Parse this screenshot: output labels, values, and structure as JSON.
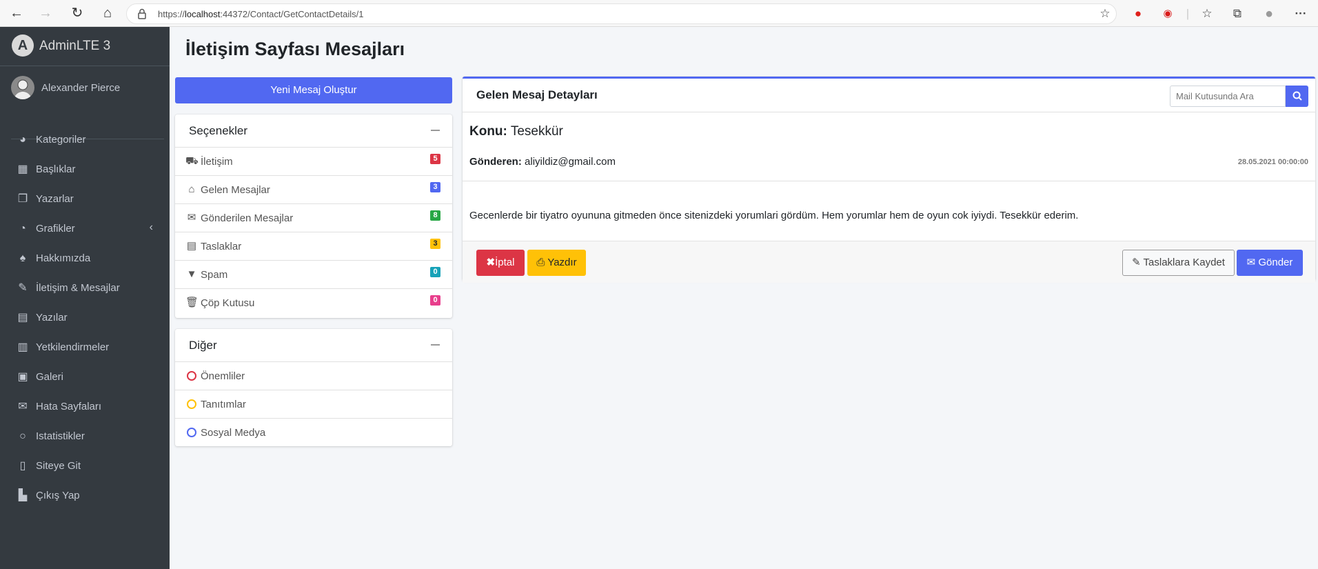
{
  "browser": {
    "url_prefix": "https://",
    "url_host": "localhost",
    "url_rest": ":44372/Contact/GetContactDetails/1"
  },
  "sidebar": {
    "brand": "AdminLTE 3",
    "user_name": "Alexander Pierce",
    "items": [
      {
        "label": "Kategoriler",
        "icon": "dashboard-icon"
      },
      {
        "label": "Başlıklar",
        "icon": "grid-icon"
      },
      {
        "label": "Yazarlar",
        "icon": "copy-icon"
      },
      {
        "label": "Grafikler",
        "icon": "pie-chart-icon"
      },
      {
        "label": "Hakkımızda",
        "icon": "tree-icon"
      },
      {
        "label": "İletişim & Mesajlar",
        "icon": "edit-icon"
      },
      {
        "label": "Yazılar",
        "icon": "table-icon"
      },
      {
        "label": "Yetkilendirmeler",
        "icon": "calendar-icon"
      },
      {
        "label": "Galeri",
        "icon": "image-icon"
      },
      {
        "label": "Hata Sayfaları",
        "icon": "envelope-icon"
      },
      {
        "label": "Istatistikler",
        "icon": "circle-icon"
      },
      {
        "label": "Siteye Git",
        "icon": "file-icon"
      },
      {
        "label": "Çıkış Yap",
        "icon": "door-icon"
      }
    ]
  },
  "content": {
    "page_title": "İletişim Sayfası Mesajları",
    "new_message_button": "Yeni Mesaj Oluştur"
  },
  "options_card": {
    "title": "Seçenekler",
    "items": [
      {
        "label": "İletişim",
        "badge": "5",
        "badge_color": "#dc3545",
        "icon": "truck-icon"
      },
      {
        "label": "Gelen Mesajlar",
        "badge": "3",
        "badge_color": "#5168f1",
        "icon": "inbox-icon"
      },
      {
        "label": "Gönderilen Mesajlar",
        "badge": "8",
        "badge_color": "#28a745",
        "icon": "envelope-icon"
      },
      {
        "label": "Taslaklar",
        "badge": "3",
        "badge_color": "#ffc107",
        "icon": "file-text-icon"
      },
      {
        "label": "Spam",
        "badge": "0",
        "badge_color": "#17a2b8",
        "icon": "filter-icon"
      },
      {
        "label": "Çöp Kutusu",
        "badge": "0",
        "badge_color": "#e83e8c",
        "icon": "trash-icon"
      }
    ]
  },
  "other_card": {
    "title": "Diğer",
    "items": [
      {
        "label": "Önemliler",
        "circle_color": "#dc3545"
      },
      {
        "label": "Tanıtımlar",
        "circle_color": "#ffc107"
      },
      {
        "label": "Sosyal Medya",
        "circle_color": "#5168f1"
      }
    ]
  },
  "detail": {
    "title": "Gelen Mesaj Detayları",
    "search_placeholder": "Mail Kutusunda Ara",
    "subject_label": "Konu:",
    "subject_value": "Tesekkür",
    "sender_label": "Gönderen:",
    "sender_value": "aliyildiz@gmail.com",
    "date": "28.05.2021 00:00:00",
    "body": "Gecenlerde bir tiyatro oyununa gitmeden önce sitenizdeki yorumlari gördüm. Hem yorumlar hem de oyun cok iyiydi. Tesekkür ederim.",
    "cancel_label": "İptal",
    "print_label": "Yazdır",
    "draft_label": "Taslaklara Kaydet",
    "send_label": "Gönder"
  },
  "colors": {
    "primary": "#5168f1",
    "danger": "#dc3545",
    "warning": "#ffc107",
    "sidebar_bg": "#343a40"
  }
}
